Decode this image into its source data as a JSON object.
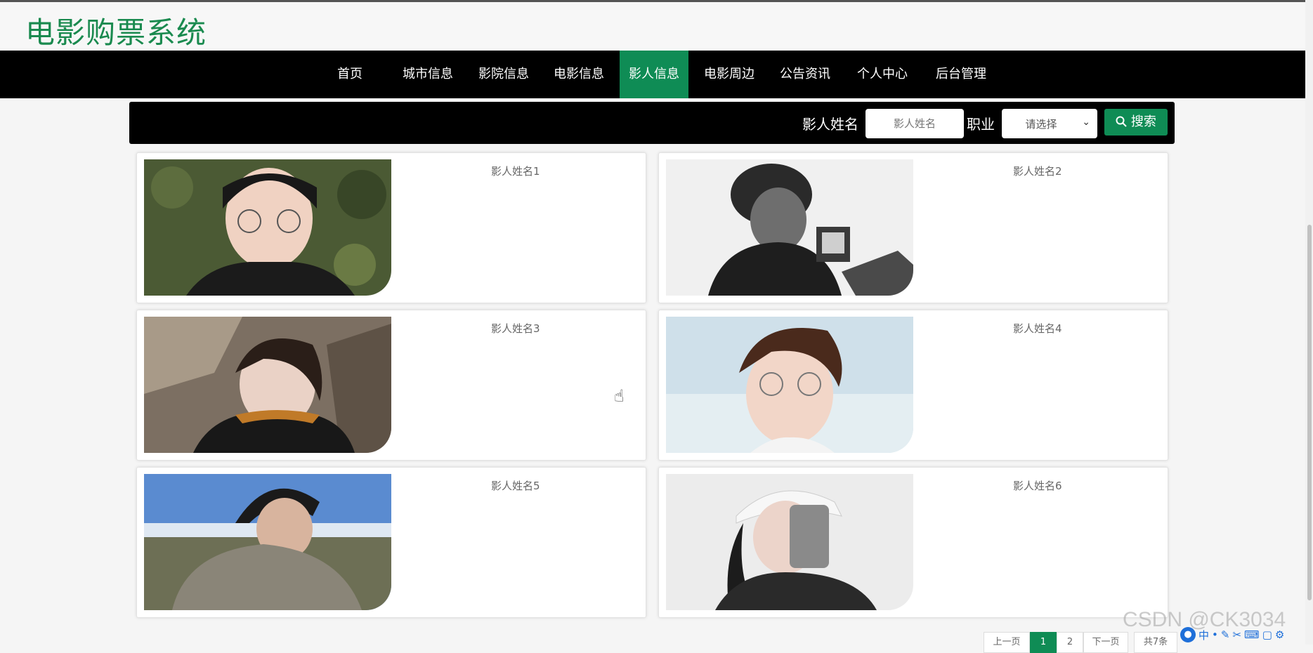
{
  "app": {
    "title": "电影购票系统"
  },
  "nav": {
    "items": [
      {
        "label": "首页",
        "active": false
      },
      {
        "label": "城市信息",
        "active": false
      },
      {
        "label": "影院信息",
        "active": false
      },
      {
        "label": "电影信息",
        "active": false
      },
      {
        "label": "影人信息",
        "active": true
      },
      {
        "label": "电影周边",
        "active": false
      },
      {
        "label": "公告资讯",
        "active": false
      },
      {
        "label": "个人中心",
        "active": false
      },
      {
        "label": "后台管理",
        "active": false
      }
    ]
  },
  "search": {
    "name_label": "影人姓名",
    "name_placeholder": "影人姓名",
    "job_label": "职业",
    "job_value": "请选择",
    "button_label": "搜索"
  },
  "people": [
    {
      "name": "影人姓名1"
    },
    {
      "name": "影人姓名2"
    },
    {
      "name": "影人姓名3"
    },
    {
      "name": "影人姓名4"
    },
    {
      "name": "影人姓名5"
    },
    {
      "name": "影人姓名6"
    }
  ],
  "pagination": {
    "prev": "上一页",
    "pages": [
      "1",
      "2"
    ],
    "current": "1",
    "next": "下一页",
    "total": "共7条"
  },
  "watermark": "CSDN @CK3034",
  "ime": "中",
  "colors": {
    "accent": "#0f8c55",
    "brand": "#1a8a4f",
    "nav_bg": "#000000"
  }
}
